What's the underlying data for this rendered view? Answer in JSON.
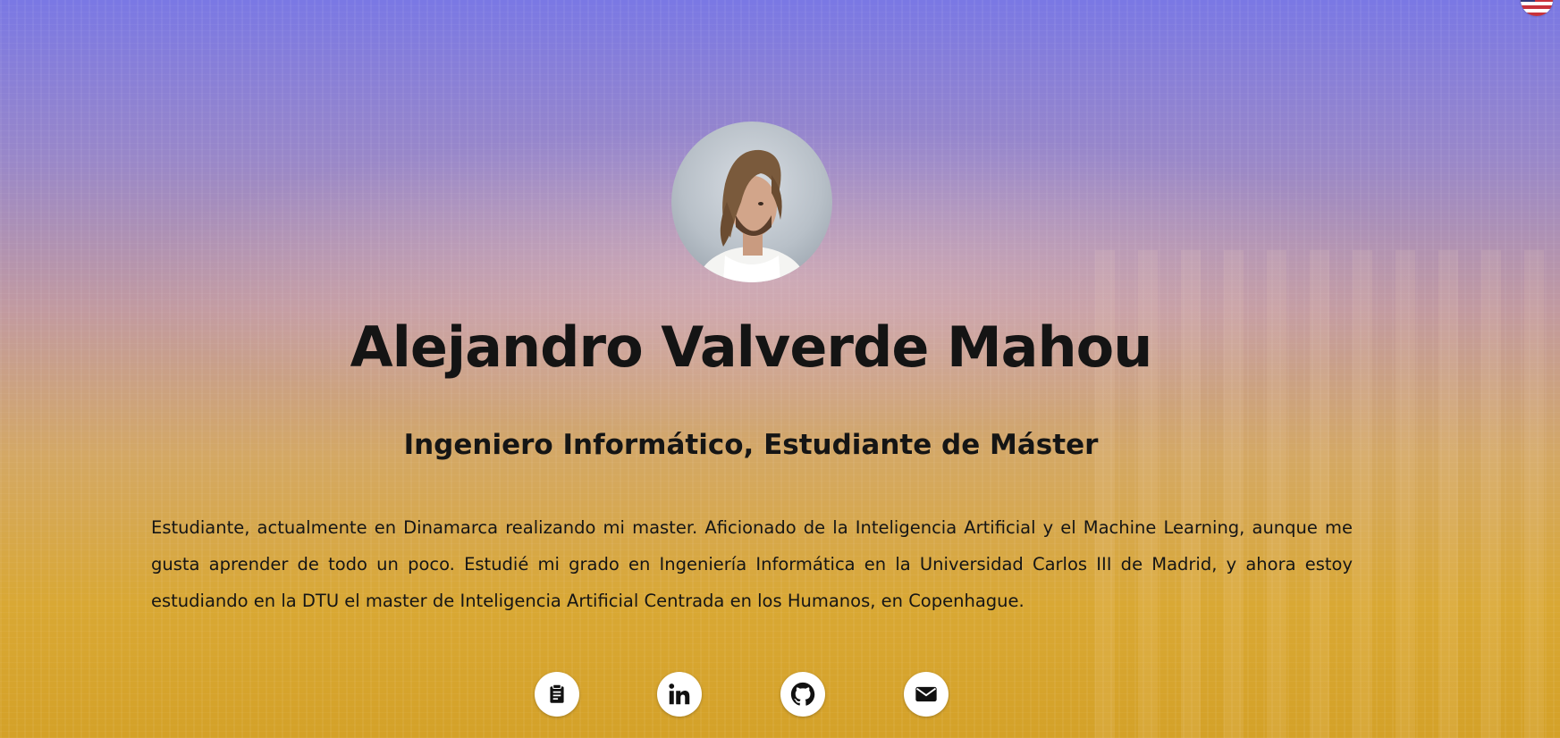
{
  "language_toggle": {
    "icon": "us-flag-icon"
  },
  "profile": {
    "name": "Alejandro Valverde Mahou",
    "title": "Ingeniero Informático, Estudiante de Máster",
    "bio": "Estudiante, actualmente en Dinamarca realizando mi master. Aficionado de la Inteligencia Artificial y el Machine Learning, aunque me gusta aprender de todo un poco. Estudié mi grado en Ingeniería Informática en la Universidad Carlos III de Madrid, y ahora estoy estudiando en la DTU el master de Inteligencia Artificial Centrada en los Humanos, en Copenhague."
  },
  "social_links": [
    {
      "icon": "resume-icon"
    },
    {
      "icon": "linkedin-icon"
    },
    {
      "icon": "github-icon"
    },
    {
      "icon": "email-icon"
    }
  ],
  "colors": {
    "gradient_top": "#7a78e4",
    "gradient_bottom": "#d4a128",
    "text": "#141414",
    "icon_button_bg": "#ffffff",
    "icon_fg": "#111111"
  }
}
